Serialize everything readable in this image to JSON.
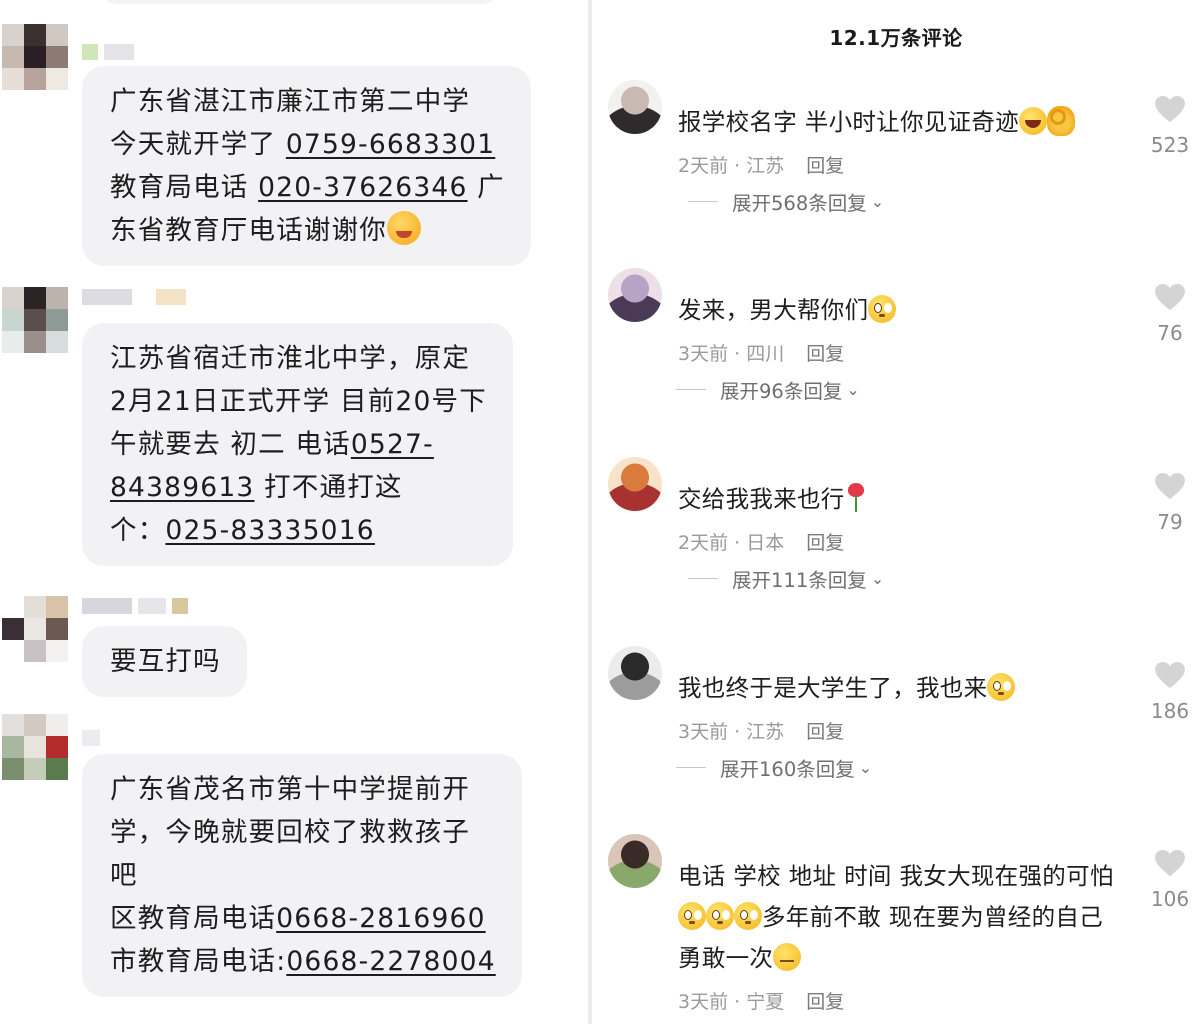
{
  "chat": {
    "messages": [
      {
        "lines": [
          [
            {
              "t": "广东省湛江市廉江市第二中学"
            }
          ],
          [
            {
              "t": " 今天就开学了 "
            },
            {
              "t": "0759-6683301",
              "u": true
            }
          ],
          [
            {
              "t": "教育局电话 "
            },
            {
              "t": "020-37626346",
              "u": true
            },
            {
              "t": " 广"
            }
          ],
          [
            {
              "t": "东省教育厅电话谢谢你"
            },
            {
              "emoji": "pleading-face"
            }
          ]
        ]
      },
      {
        "lines": [
          [
            {
              "t": "江苏省宿迁市淮北中学，原定"
            }
          ],
          [
            {
              "t": "2月21日正式开学 目前20号下"
            }
          ],
          [
            {
              "t": "午就要去 初二 电话"
            },
            {
              "t": "0527-",
              "u": true
            }
          ],
          [
            {
              "t": "84389613",
              "u": true
            },
            {
              "t": "          打不通打这"
            }
          ],
          [
            {
              "t": "个："
            },
            {
              "t": "025-83335016",
              "u": true
            }
          ]
        ]
      },
      {
        "lines": [
          [
            {
              "t": "要互打吗"
            }
          ]
        ]
      },
      {
        "lines": [
          [
            {
              "t": "广东省茂名市第十中学提前开"
            }
          ],
          [
            {
              "t": "学，今晚就要回校了救救孩子"
            }
          ],
          [
            {
              "t": "吧"
            }
          ],
          [
            {
              "t": "区教育局电话"
            },
            {
              "t": "0668-2816960",
              "u": true
            }
          ],
          [
            {
              "t": "市教育局电话:"
            },
            {
              "t": "0668-2278004",
              "u": true
            }
          ]
        ]
      }
    ]
  },
  "comments": {
    "header": "12.1万条评论",
    "reply_label": "回复",
    "items": [
      {
        "text_lines": [
          [
            {
              "t": "报学校名字 半小时让你见证奇迹"
            },
            {
              "emoji": "rofl"
            },
            {
              "emoji": "ok-hand"
            }
          ]
        ],
        "meta": "2天前 · 江苏",
        "expand": "展开568条回复",
        "likes": "523",
        "avatar": "avatar-1"
      },
      {
        "text_lines": [
          [
            {
              "t": "发来，男大帮你们"
            },
            {
              "emoji": "eyes-face"
            }
          ]
        ],
        "meta": "3天前 · 四川",
        "expand": "展开96条回复",
        "likes": "76",
        "avatar": "avatar-2"
      },
      {
        "text_lines": [
          [
            {
              "t": "交给我我来也行"
            },
            {
              "emoji": "rose"
            }
          ]
        ],
        "meta": "2天前 · 日本",
        "expand": "展开111条回复",
        "likes": "79",
        "avatar": "avatar-3"
      },
      {
        "text_lines": [
          [
            {
              "t": "我也终于是大学生了，我也来"
            },
            {
              "emoji": "eyes-face"
            }
          ]
        ],
        "meta": "3天前 · 江苏",
        "expand": "展开160条回复",
        "likes": "186",
        "avatar": "avatar-4"
      },
      {
        "text_lines": [
          [
            {
              "t": "电话 学校 地址 时间 我女大现在强的可怕"
            }
          ],
          [
            {
              "emoji": "eyes-face"
            },
            {
              "emoji": "eyes-face"
            },
            {
              "emoji": "eyes-face"
            },
            {
              "t": "多年前不敢 现在要为曾经的自己"
            }
          ],
          [
            {
              "t": "勇敢一次"
            },
            {
              "emoji": "unamused-face"
            }
          ]
        ],
        "meta": "3天前 · 宁夏",
        "likes": "106",
        "avatar": "avatar-5"
      }
    ]
  },
  "icons": {
    "like": "heart-icon",
    "expand": "chevron-down-icon"
  },
  "colors": {
    "bubble": "#f2f2f4",
    "heart": "#d4d4d4",
    "meta_text": "#9a9a9a"
  }
}
